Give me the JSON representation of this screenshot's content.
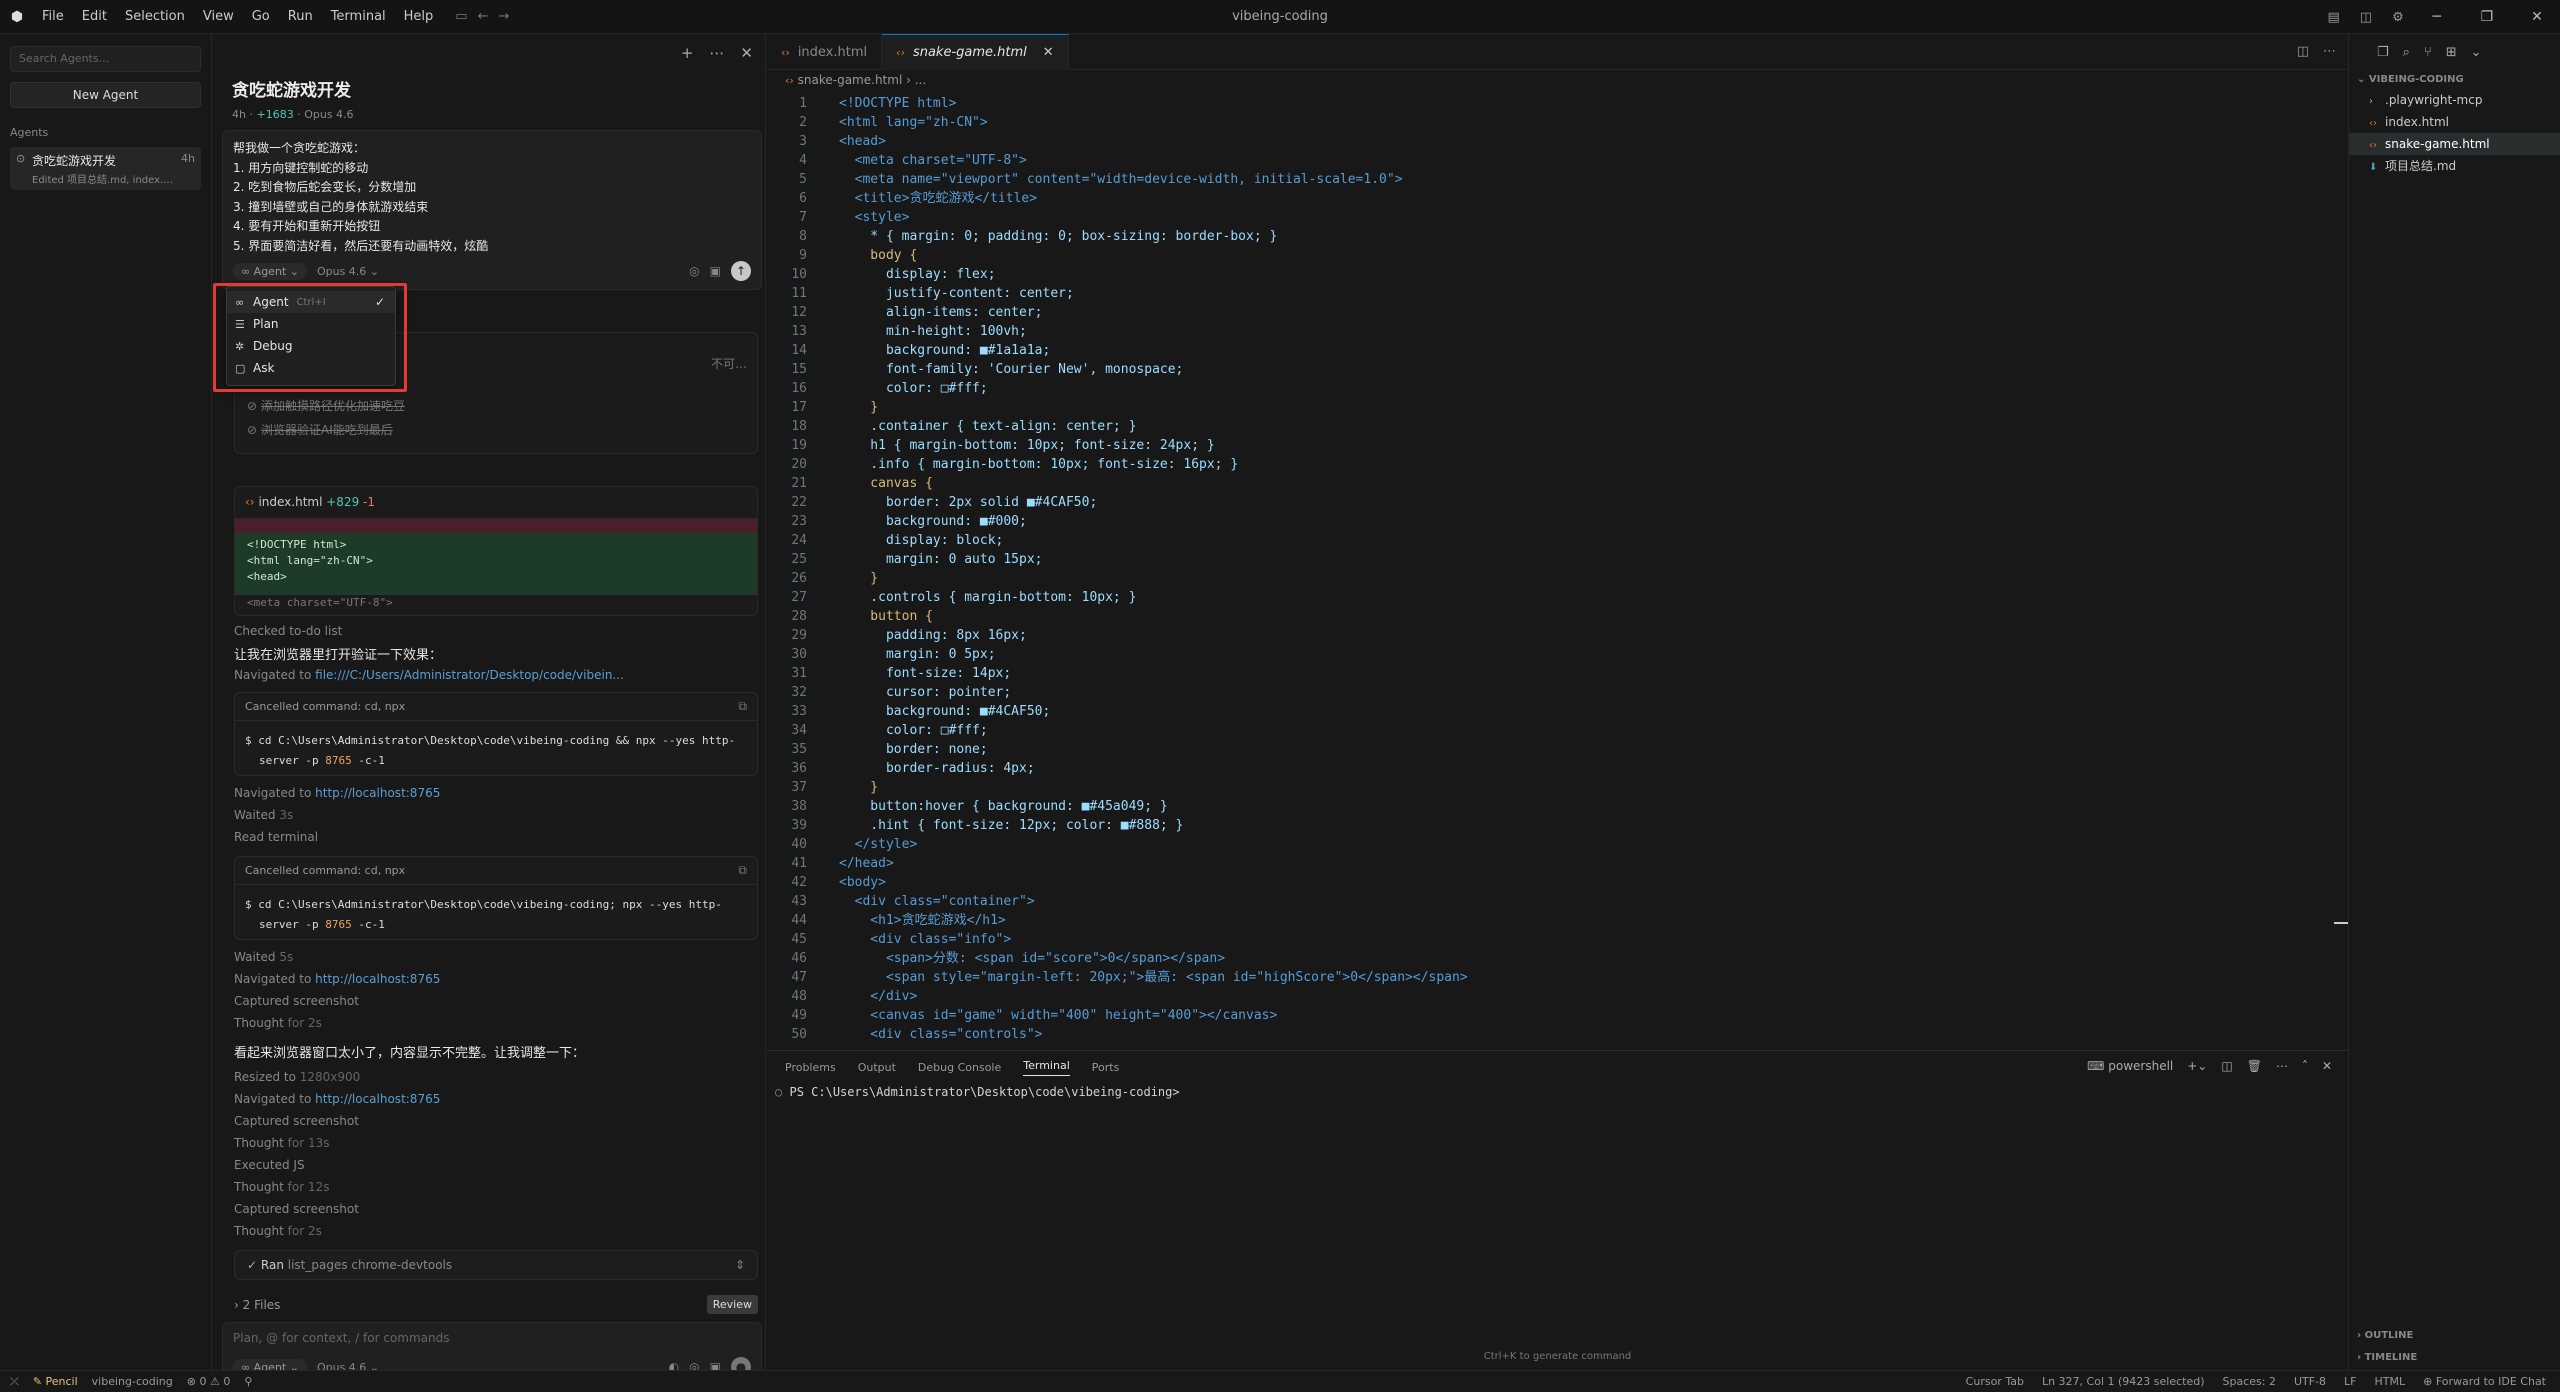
{
  "window": {
    "title": "vibeing-coding",
    "menu": [
      "File",
      "Edit",
      "Selection",
      "View",
      "Go",
      "Run",
      "Terminal",
      "Help"
    ]
  },
  "agents_sidebar": {
    "search_placeholder": "Search Agents...",
    "new_agent": "New Agent",
    "section": "Agents",
    "items": [
      {
        "title": "贪吃蛇游戏开发",
        "time": "4h",
        "subtitle": "Edited 项目总结.md, index...."
      }
    ]
  },
  "chat": {
    "title": "贪吃蛇游戏开发",
    "meta_time": "4h",
    "meta_added": "+1683",
    "meta_model": "Opus 4.6",
    "prompt_lines": [
      "帮我做一个贪吃蛇游戏：",
      "1. 用方向键控制蛇的移动",
      "2. 吃到食物后蛇会变长，分数增加",
      "3. 撞到墙壁或自己的身体就游戏结束",
      "4. 要有开始和重新开始按钮",
      "5. 界面要简洁好看，然后还要有动画特效，炫酷"
    ],
    "prompt_mode": "Agent",
    "prompt_model": "Opus 4.6",
    "todo_partial": "不可…",
    "todos": [
      "添加触摸路径优化加速吃豆",
      "浏览器验证AI能吃到最后"
    ],
    "diff_file": "index.html",
    "diff_added": "+829",
    "diff_removed": "-1",
    "diff_lines": [
      "<!DOCTYPE html>",
      "<html lang=\"zh-CN\">",
      "<head>"
    ],
    "diff_faded": "<meta charset=\"UTF-8\">",
    "checked_todo": "Checked to-do list",
    "msg1": "让我在浏览器里打开验证一下效果：",
    "navigated_file_label": "Navigated to",
    "navigated_file": "file:///C:/Users/Administrator/Desktop/code/vibein...",
    "cmd1_header": "Cancelled command: cd, npx",
    "cmd1_line1": "$ cd C:\\Users\\Administrator\\Desktop\\code\\vibeing-coding && npx --yes http-",
    "cmd1_line2_pre": "server -p ",
    "cmd1_port": "8765",
    "cmd1_line2_post": " -c-1",
    "nav1_label": "Navigated to",
    "nav1_url": "http://localhost:8765",
    "waited1_label": "Waited",
    "waited1_val": "3s",
    "read_terminal": "Read terminal",
    "cmd2_header": "Cancelled command: cd, npx",
    "cmd2_line1": "$ cd C:\\Users\\Administrator\\Desktop\\code\\vibeing-coding; npx --yes http-",
    "cmd2_line2_pre": "server -p ",
    "cmd2_port": "8765",
    "cmd2_line2_post": " -c-1",
    "waited2_label": "Waited",
    "waited2_val": "5s",
    "nav2_label": "Navigated to",
    "nav2_url": "http://localhost:8765",
    "captured1": "Captured screenshot",
    "thought1_label": "Thought",
    "thought1_val": "for 2s",
    "msg2": "看起来浏览器窗口太小了，内容显示不完整。让我调整一下：",
    "resized_label": "Resized to",
    "resized_val": "1280x900",
    "nav3_label": "Navigated to",
    "nav3_url": "http://localhost:8765",
    "captured2": "Captured screenshot",
    "thought2_label": "Thought",
    "thought2_val": "for 13s",
    "executed": "Executed JS",
    "thought3_label": "Thought",
    "thought3_val": "for 12s",
    "captured3": "Captured screenshot",
    "thought4_label": "Thought",
    "thought4_val": "for 2s",
    "ran_label": "Ran",
    "ran_sub": "list_pages chrome-devtools",
    "files_label": "2 Files",
    "review": "Review",
    "input_placeholder": "Plan, @ for context, / for commands",
    "input_mode": "Agent",
    "input_model": "Opus 4.6"
  },
  "mode_dropdown": {
    "options": [
      {
        "label": "Agent",
        "shortcut": "Ctrl+I",
        "icon": "infinity-icon",
        "selected": true
      },
      {
        "label": "Plan",
        "shortcut": "",
        "icon": "list-icon",
        "selected": false
      },
      {
        "label": "Debug",
        "shortcut": "",
        "icon": "bug-icon",
        "selected": false
      },
      {
        "label": "Ask",
        "shortcut": "",
        "icon": "chat-icon",
        "selected": false
      }
    ]
  },
  "editor": {
    "tabs": [
      {
        "label": "index.html",
        "active": false
      },
      {
        "label": "snake-game.html",
        "active": true
      }
    ],
    "breadcrumb": "snake-game.html",
    "breadcrumb_more": "...",
    "lines": [
      "<!DOCTYPE html>",
      "<html lang=\"zh-CN\">",
      "<head>",
      "  <meta charset=\"UTF-8\">",
      "  <meta name=\"viewport\" content=\"width=device-width, initial-scale=1.0\">",
      "  <title>贪吃蛇游戏</title>",
      "  <style>",
      "    * { margin: 0; padding: 0; box-sizing: border-box; }",
      "    body {",
      "      display: flex;",
      "      justify-content: center;",
      "      align-items: center;",
      "      min-height: 100vh;",
      "      background: ■#1a1a1a;",
      "      font-family: 'Courier New', monospace;",
      "      color: □#fff;",
      "    }",
      "    .container { text-align: center; }",
      "    h1 { margin-bottom: 10px; font-size: 24px; }",
      "    .info { margin-bottom: 10px; font-size: 16px; }",
      "    canvas {",
      "      border: 2px solid ■#4CAF50;",
      "      background: ■#000;",
      "      display: block;",
      "      margin: 0 auto 15px;",
      "    }",
      "    .controls { margin-bottom: 10px; }",
      "    button {",
      "      padding: 8px 16px;",
      "      margin: 0 5px;",
      "      font-size: 14px;",
      "      cursor: pointer;",
      "      background: ■#4CAF50;",
      "      color: □#fff;",
      "      border: none;",
      "      border-radius: 4px;",
      "    }",
      "    button:hover { background: ■#45a049; }",
      "    .hint { font-size: 12px; color: ■#888; }",
      "  </style>",
      "</head>",
      "<body>",
      "  <div class=\"container\">",
      "    <h1>贪吃蛇游戏</h1>",
      "    <div class=\"info\">",
      "      <span>分数: <span id=\"score\">0</span></span>",
      "      <span style=\"margin-left: 20px;\">最高: <span id=\"highScore\">0</span></span>",
      "    </div>",
      "    <canvas id=\"game\" width=\"400\" height=\"400\"></canvas>",
      "    <div class=\"controls\">"
    ]
  },
  "panel": {
    "tabs": [
      "Problems",
      "Output",
      "Debug Console",
      "Terminal",
      "Ports"
    ],
    "active_tab": "Terminal",
    "shell": "powershell",
    "prompt": "PS C:\\Users\\Administrator\\Desktop\\code\\vibeing-coding>",
    "hint": "Ctrl+K to generate command"
  },
  "explorer": {
    "root": "VIBEING-CODING",
    "items": [
      {
        "label": ".playwright-mcp",
        "type": "folder"
      },
      {
        "label": "index.html",
        "type": "html"
      },
      {
        "label": "snake-game.html",
        "type": "html",
        "selected": true
      },
      {
        "label": "项目总结.md",
        "type": "md"
      }
    ],
    "outline": "OUTLINE",
    "timeline": "TIMELINE"
  },
  "statusbar": {
    "mode": "Pencil",
    "workspace": "vibeing-coding",
    "problems": "⊗ 0 ⚠ 0",
    "cursor_tab": "Cursor Tab",
    "position": "Ln 327, Col 1 (9423 selected)",
    "spaces": "Spaces: 2",
    "encoding": "UTF-8",
    "eol": "LF",
    "language": "HTML",
    "forward": "Forward to IDE Chat"
  }
}
